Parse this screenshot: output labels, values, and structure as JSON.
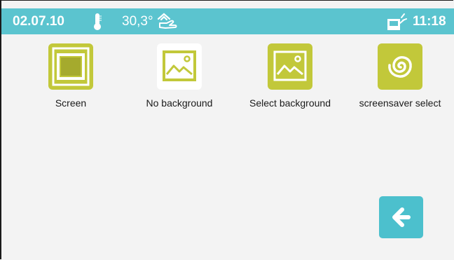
{
  "status_bar": {
    "date": "02.07.10",
    "temperature": "30,3°",
    "time": "11:18",
    "icons": [
      "thermometer-icon",
      "hand-gesture-icon",
      "intercom-icon"
    ]
  },
  "colors": {
    "status_bar": "#5bc4cf",
    "tile_accent": "#c2c83a",
    "back_button": "#4cc0cd",
    "background": "#f3f3f3"
  },
  "tiles": [
    {
      "label": "Screen",
      "icon": "screen-icon"
    },
    {
      "label": "No background",
      "icon": "image-icon"
    },
    {
      "label": "Select background",
      "icon": "image-icon"
    },
    {
      "label": "screensaver select",
      "icon": "spiral-icon"
    }
  ],
  "back_button": {
    "icon": "arrow-left-icon"
  }
}
